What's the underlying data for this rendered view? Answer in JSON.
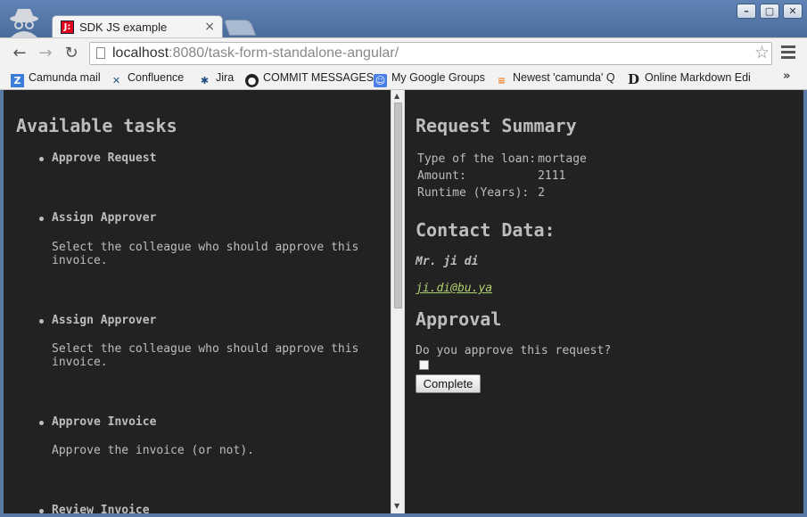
{
  "browser": {
    "tab_title": "SDK JS example",
    "favicon_text": "J:",
    "url_host": "localhost",
    "url_path": ":8080/task-form-standalone-angular/",
    "bookmarks": [
      {
        "label": "Camunda mail",
        "icon": "camunda-mail-icon"
      },
      {
        "label": "Confluence",
        "icon": "confluence-icon"
      },
      {
        "label": "Jira",
        "icon": "jira-icon"
      },
      {
        "label": "COMMIT MESSAGES",
        "icon": "github-icon"
      },
      {
        "label": "My Google Groups",
        "icon": "google-groups-icon"
      },
      {
        "label": "Newest 'camunda' Q",
        "icon": "stackoverflow-icon"
      },
      {
        "label": "Online Markdown Edi",
        "icon": "markdown-editor-icon"
      }
    ],
    "more_bookmarks": "»"
  },
  "tasks": {
    "heading": "Available tasks",
    "items": [
      {
        "name": "Approve Request",
        "description": ""
      },
      {
        "name": "Assign Approver",
        "description": "Select the colleague who should approve this invoice."
      },
      {
        "name": "Assign Approver",
        "description": "Select the colleague who should approve this invoice."
      },
      {
        "name": "Approve Invoice",
        "description": "Approve the invoice (or not)."
      },
      {
        "name": "Review Invoice",
        "description": ""
      }
    ]
  },
  "form": {
    "summary_heading": "Request Summary",
    "summary_rows": [
      {
        "label": "Type of the loan:",
        "value": "mortage"
      },
      {
        "label": "Amount:",
        "value": "2111"
      },
      {
        "label": "Runtime (Years):",
        "value": "2"
      }
    ],
    "contact_heading": "Contact Data:",
    "contact_name": "Mr. ji di",
    "contact_email": "ji.di@bu.ya",
    "approval_heading": "Approval",
    "approval_question": "Do you approve this request?",
    "approved_checked": false,
    "complete_label": "Complete"
  },
  "colors": {
    "page_background": "#222222",
    "text": "#bdbdbd",
    "link": "#b0d26e"
  }
}
